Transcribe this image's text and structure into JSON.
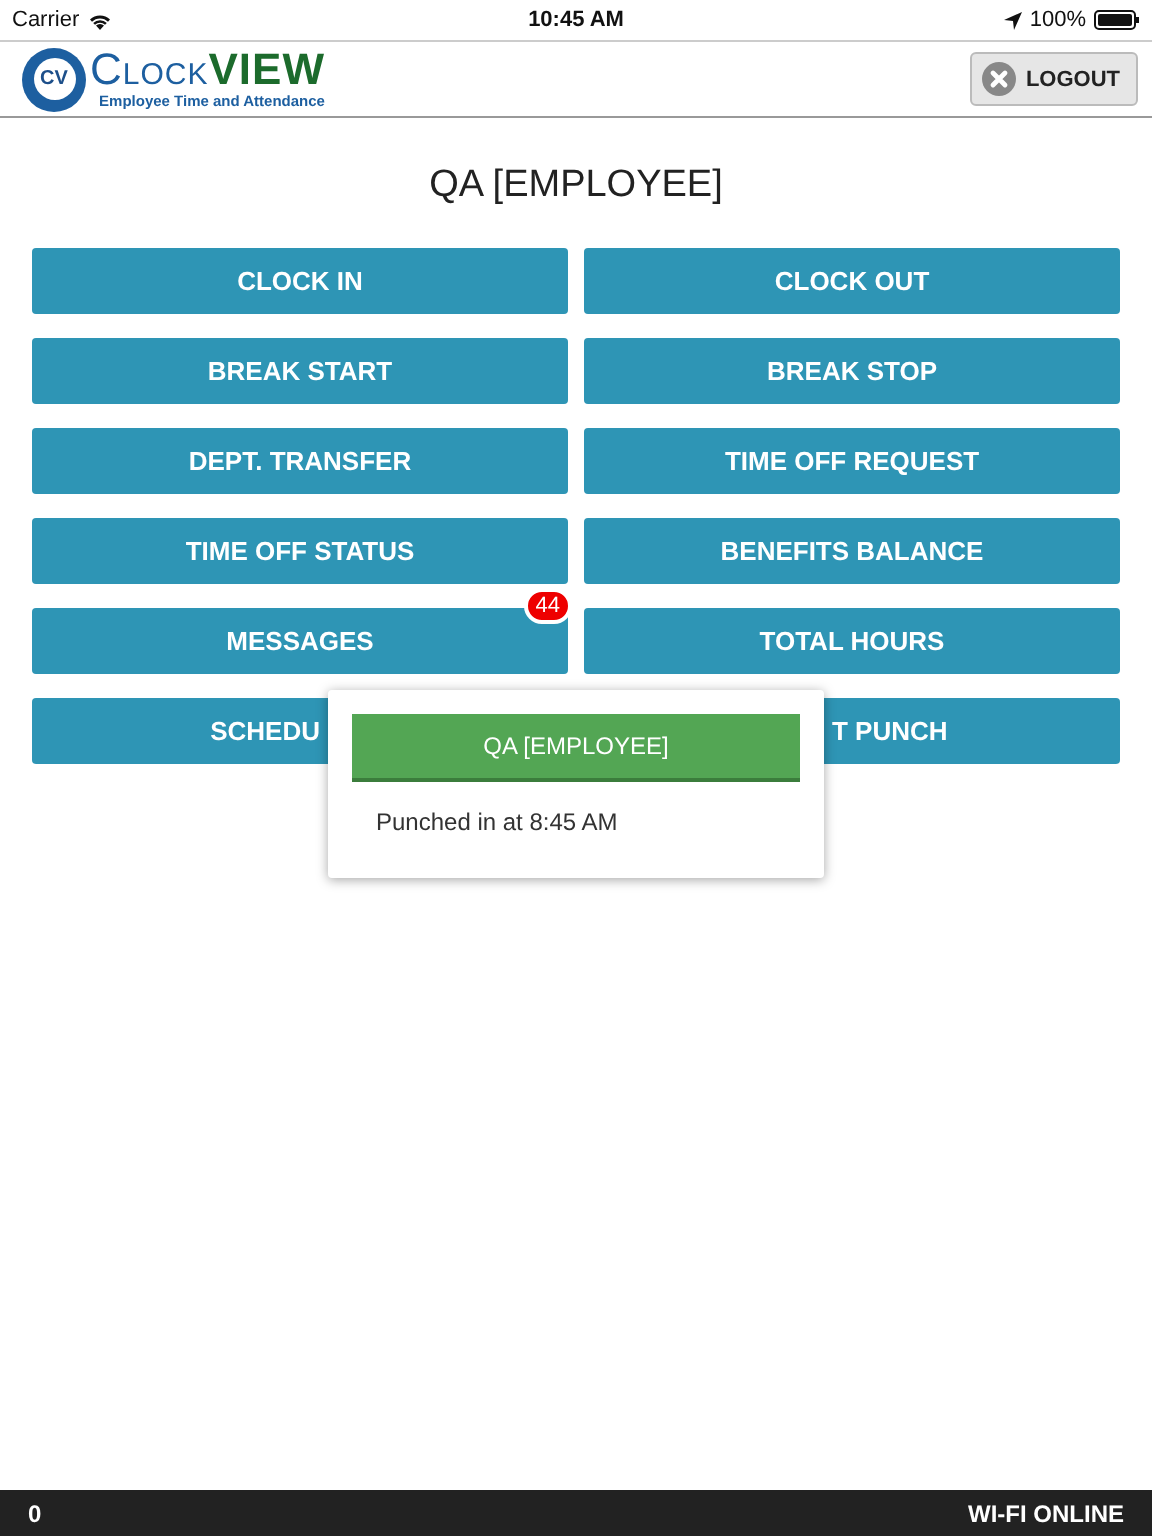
{
  "status_bar": {
    "carrier": "Carrier",
    "time": "10:45 AM",
    "battery": "100%"
  },
  "header": {
    "logo": {
      "badge": "CV",
      "name": [
        "Clock",
        "VIEW"
      ],
      "tagline": "Employee Time and Attendance"
    },
    "logout": "LOGOUT"
  },
  "title": "QA [EMPLOYEE]",
  "buttons": [
    {
      "label": "CLOCK IN"
    },
    {
      "label": "CLOCK OUT"
    },
    {
      "label": "BREAK START"
    },
    {
      "label": "BREAK STOP"
    },
    {
      "label": "DEPT. TRANSFER"
    },
    {
      "label": "TIME OFF REQUEST"
    },
    {
      "label": "TIME OFF STATUS"
    },
    {
      "label": "BENEFITS BALANCE"
    },
    {
      "label": "MESSAGES",
      "badge": "44"
    },
    {
      "label": "TOTAL HOURS"
    },
    {
      "label": "SCHEDU",
      "covered": true
    },
    {
      "label": "T PUNCH",
      "covered": true
    }
  ],
  "popup": {
    "heading": "QA [EMPLOYEE]",
    "message": "Punched in at 8:45 AM"
  },
  "footer": {
    "count": "0",
    "connection": "WI-FI ONLINE"
  }
}
